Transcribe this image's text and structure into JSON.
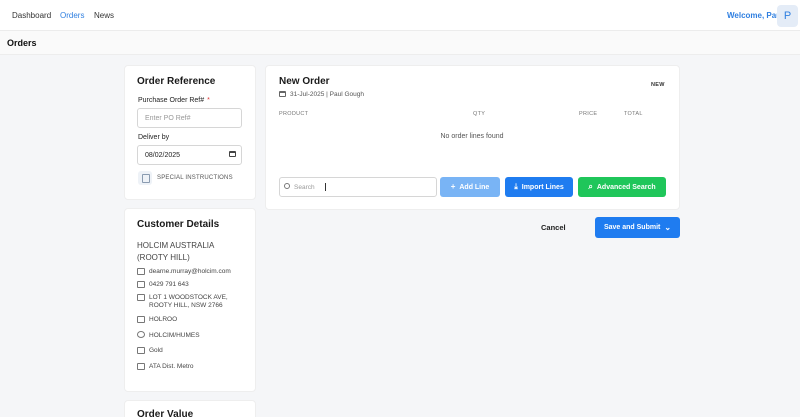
{
  "nav": {
    "items": [
      {
        "label": "Dashboard"
      },
      {
        "label": "Orders"
      },
      {
        "label": "News"
      }
    ],
    "welcome": "Welcome, Paul",
    "avatar_initial": "P"
  },
  "page": {
    "title": "Orders"
  },
  "order_reference": {
    "title": "Order Reference",
    "po_label": "Purchase Order Ref#",
    "po_required": "*",
    "po_placeholder": "Enter PO Ref#",
    "deliver_label": "Deliver by",
    "deliver_value": "08/02/2025",
    "special_instructions": "SPECIAL INSTRUCTIONS"
  },
  "customer": {
    "title": "Customer Details",
    "name": "HOLCIM AUSTRALIA (ROOTY HILL)",
    "email": "dearne.murray@holcim.com",
    "phone": "0429 791 643",
    "address": "LOT 1 WOODSTOCK AVE, ROOTY HILL, NSW 2766",
    "code": "HOLROO",
    "group": "HOLCIM/HUMES",
    "tier": "Gold",
    "region": "ATA Dist. Metro"
  },
  "order_value": {
    "title": "Order Value"
  },
  "new_order": {
    "title": "New Order",
    "meta": "31-Jul-2025 | Paul Gough",
    "badge": "NEW",
    "columns": [
      "PRODUCT",
      "QTY",
      "PRICE",
      "TOTAL"
    ],
    "empty_message": "No order lines found",
    "search_placeholder": "Search",
    "add_line": "Add Line",
    "import_lines": "Import Lines",
    "advanced_search": "Advanced Search"
  },
  "actions": {
    "cancel": "Cancel",
    "save_submit": "Save and Submit"
  },
  "colors": {
    "accent": "#1f7cf0",
    "accent_light": "#79b4f5",
    "success": "#1fc65a"
  }
}
